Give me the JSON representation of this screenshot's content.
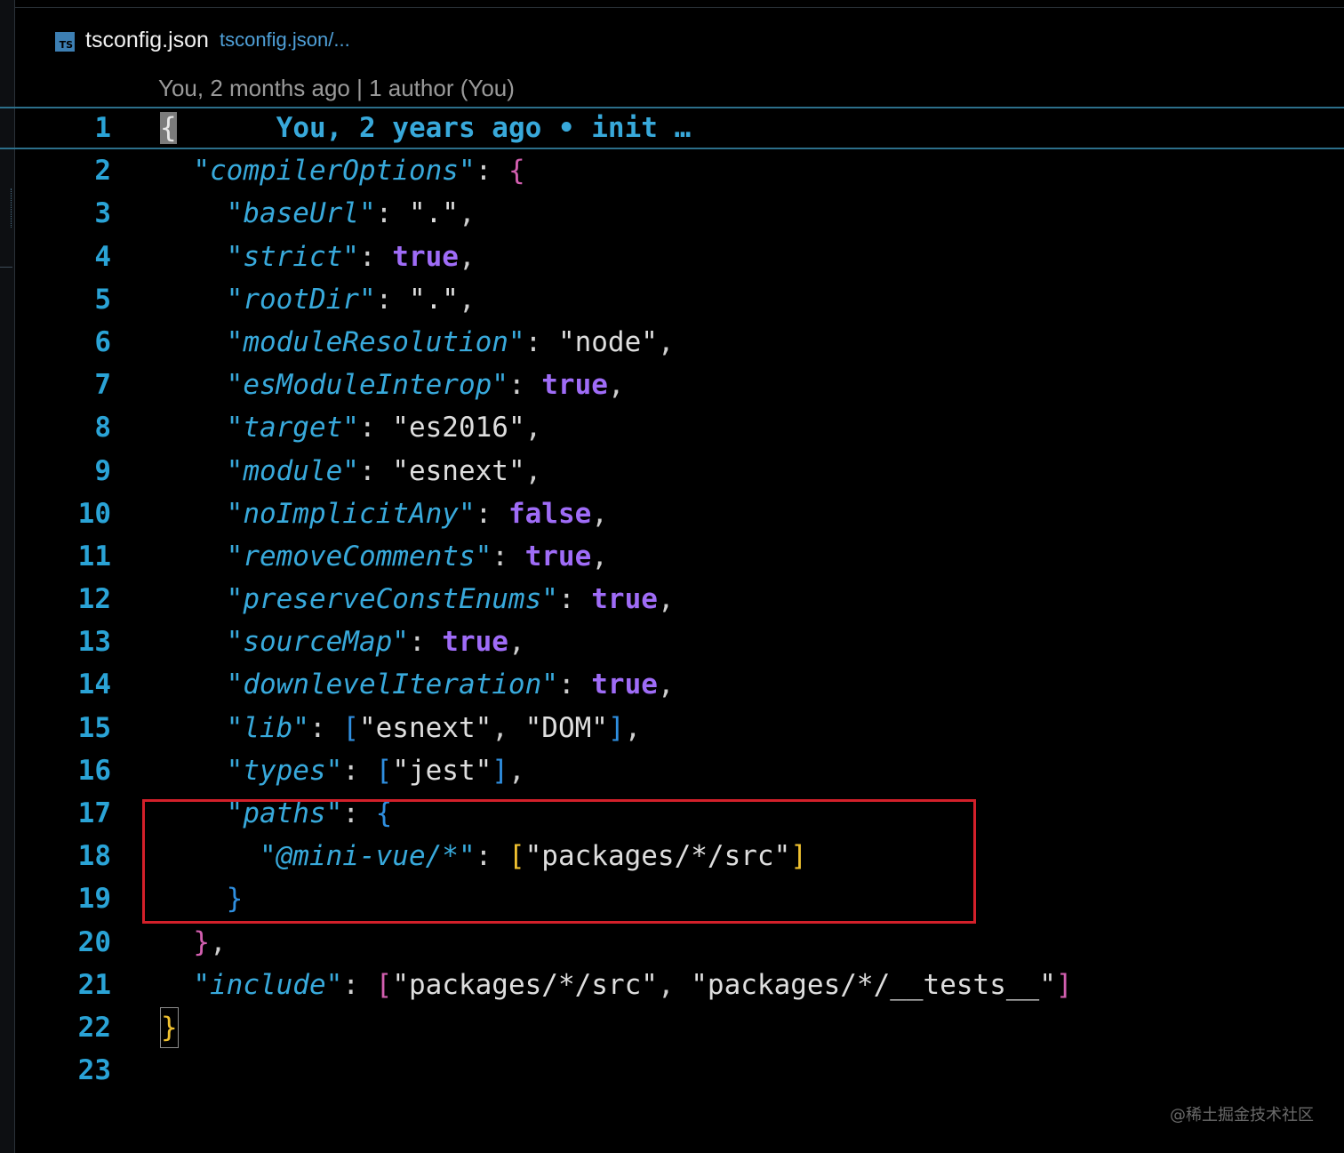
{
  "window": {
    "tab_icon": "typescript-file-icon",
    "tab_title": "tsconfig.json",
    "tab_path": "tsconfig.json/..."
  },
  "codelens": "You, 2 months ago | 1 author (You)",
  "blame_line1": "You, 2 years ago • init …",
  "line_numbers": [
    "1",
    "2",
    "3",
    "4",
    "5",
    "6",
    "7",
    "8",
    "9",
    "10",
    "11",
    "12",
    "13",
    "14",
    "15",
    "16",
    "17",
    "18",
    "19",
    "20",
    "21",
    "22",
    "23"
  ],
  "code": {
    "l1_brace": "{",
    "compilerOptions": "\"compilerOptions\"",
    "baseUrl_key": "\"baseUrl\"",
    "baseUrl_val": "\".\"",
    "strict_key": "\"strict\"",
    "strict_val": "true",
    "rootDir_key": "\"rootDir\"",
    "rootDir_val": "\".\"",
    "moduleResolution_key": "\"moduleResolution\"",
    "moduleResolution_val": "\"node\"",
    "esModuleInterop_key": "\"esModuleInterop\"",
    "esModuleInterop_val": "true",
    "target_key": "\"target\"",
    "target_val": "\"es2016\"",
    "module_key": "\"module\"",
    "module_val": "\"esnext\"",
    "noImplicitAny_key": "\"noImplicitAny\"",
    "noImplicitAny_val": "false",
    "removeComments_key": "\"removeComments\"",
    "removeComments_val": "true",
    "preserveConstEnums_key": "\"preserveConstEnums\"",
    "preserveConstEnums_val": "true",
    "sourceMap_key": "\"sourceMap\"",
    "sourceMap_val": "true",
    "downlevelIteration_key": "\"downlevelIteration\"",
    "downlevelIteration_val": "true",
    "lib_key": "\"lib\"",
    "lib_val1": "\"esnext\"",
    "lib_val2": "\"DOM\"",
    "types_key": "\"types\"",
    "types_val": "\"jest\"",
    "paths_key": "\"paths\"",
    "alias_key": "\"@mini-vue/*\"",
    "alias_val": "\"packages/*/src\"",
    "include_key": "\"include\"",
    "include_val1": "\"packages/*/src\"",
    "include_val2": "\"packages/*/__tests__\"",
    "final_brace": "}"
  },
  "watermark": "@稀土掘金技术社区",
  "colors": {
    "background": "#000000",
    "line_number": "#2aa3d6",
    "key": "#38a9db",
    "boolean": "#9f6cf7",
    "string": "#dedede",
    "highlight_box": "#d3202a"
  }
}
